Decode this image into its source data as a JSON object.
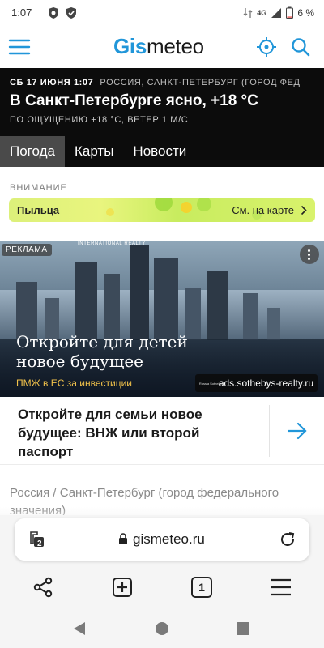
{
  "status_bar": {
    "time": "1:07",
    "network": "4G",
    "battery": "6 %"
  },
  "header": {
    "logo_bold": "Gis",
    "logo_rest": "meteo",
    "icons": [
      "menu-icon",
      "location-target-icon",
      "search-icon"
    ]
  },
  "weather": {
    "date": "СБ 17 ИЮНЯ 1:07",
    "location": "РОССИЯ, САНКТ-ПЕТЕРБУРГ (ГОРОД ФЕД",
    "title": "В Санкт-Петербурге ясно, +18 °C",
    "feels_like": "ПО ОЩУЩЕНИЮ +18 °C, ВЕТЕР 1 М/С"
  },
  "tabs": [
    {
      "label": "Погода",
      "active": true
    },
    {
      "label": "Карты",
      "active": false
    },
    {
      "label": "Новости",
      "active": false
    }
  ],
  "attention": {
    "label": "ВНИМАНИЕ",
    "pollen_label": "Пыльца",
    "map_link": "См. на карте"
  },
  "ad": {
    "badge": "РЕКЛАМА",
    "brand": "INTERNATIONAL REALTY",
    "brand_small": "Russia",
    "headline": "Откройте для детей новое будущее",
    "subline": "ПМЖ в ЕС за инвестиции",
    "url": "ads.sothebys-realty.ru",
    "url_logo_text": "Russia Sotheby's",
    "card_text": "Откройте для семьи новое будущее: ВНЖ или второй паспорт"
  },
  "breadcrumb": "Россия / Санкт-Петербург (город федерального значения)",
  "browser": {
    "url": "gismeteo.ru",
    "tabs_count": "2",
    "pages_count": "1"
  },
  "colors": {
    "brand_blue": "#2196d9",
    "dark_panel": "#0c0c0c",
    "pollen_green": "#d9f26c",
    "ad_accent": "#f2c24a"
  }
}
